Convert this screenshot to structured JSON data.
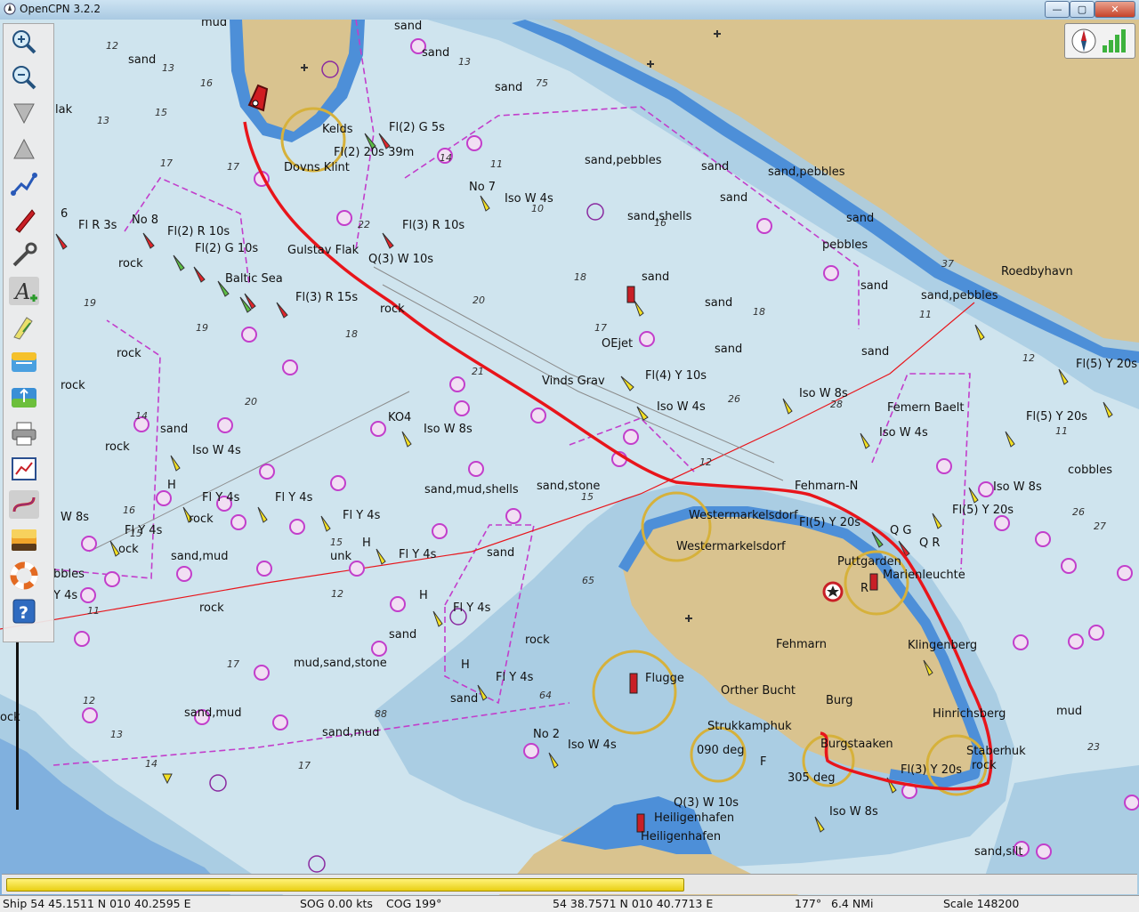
{
  "window": {
    "title": "OpenCPN 3.2.2",
    "minimize_glyph": "—",
    "maximize_glyph": "▢",
    "close_glyph": "✕"
  },
  "toolbar": {
    "tools": [
      {
        "name": "zoom-in-icon"
      },
      {
        "name": "zoom-out-icon"
      },
      {
        "name": "scale-in-icon"
      },
      {
        "name": "scale-out-icon"
      },
      {
        "name": "route-icon"
      },
      {
        "name": "follow-ship-icon"
      },
      {
        "name": "settings-wrench-icon"
      },
      {
        "name": "text-toggle-icon"
      },
      {
        "name": "current-tide-icon"
      },
      {
        "name": "tide-icon"
      },
      {
        "name": "current-icon"
      },
      {
        "name": "print-icon"
      },
      {
        "name": "route-manager-icon"
      },
      {
        "name": "track-icon"
      },
      {
        "name": "color-scheme-icon"
      },
      {
        "name": "mob-lifebuoy-icon"
      },
      {
        "name": "help-icon"
      }
    ]
  },
  "chart": {
    "labels": [
      {
        "t": "mud"
      },
      {
        "t": "sand"
      },
      {
        "t": "sand"
      },
      {
        "t": "sand"
      },
      {
        "t": "sand"
      },
      {
        "t": "lak"
      },
      {
        "t": "Kelds"
      },
      {
        "t": "Fl(2) G 5s"
      },
      {
        "t": "Fl(2) 20s 39m"
      },
      {
        "t": "Dovns Klint"
      },
      {
        "t": "sand,pebbles"
      },
      {
        "t": "sand"
      },
      {
        "t": "sand,pebbles"
      },
      {
        "t": "No 7"
      },
      {
        "t": "Iso W 4s"
      },
      {
        "t": "sand"
      },
      {
        "t": "sand,shells"
      },
      {
        "t": "sand"
      },
      {
        "t": "No 8"
      },
      {
        "t": "6"
      },
      {
        "t": "Fl R 3s"
      },
      {
        "t": "Fl(2) R 10s"
      },
      {
        "t": "Fl(2) G 10s"
      },
      {
        "t": "Gulstav Flak"
      },
      {
        "t": "Fl(3) R 10s"
      },
      {
        "t": "Q(3) W 10s"
      },
      {
        "t": "pebbles"
      },
      {
        "t": "Baltic Sea"
      },
      {
        "t": "Fl(3) R 15s"
      },
      {
        "t": "rock"
      },
      {
        "t": "rock"
      },
      {
        "t": "sand"
      },
      {
        "t": "sand"
      },
      {
        "t": "sand"
      },
      {
        "t": "sand,pebbles"
      },
      {
        "t": "Roedbyhavn"
      },
      {
        "t": "OEjet"
      },
      {
        "t": "sand"
      },
      {
        "t": "sand"
      },
      {
        "t": "Fl(4) Y 10s"
      },
      {
        "t": "Vinds Grav"
      },
      {
        "t": "Iso W 4s"
      },
      {
        "t": "Iso W 8s"
      },
      {
        "t": "Femern Baelt"
      },
      {
        "t": "Fl(5) Y 20s"
      },
      {
        "t": "Fl(5) Y 20s"
      },
      {
        "t": "rock"
      },
      {
        "t": "rock"
      },
      {
        "t": "KO4"
      },
      {
        "t": "Iso W 8s"
      },
      {
        "t": "sand"
      },
      {
        "t": "Iso W 4s"
      },
      {
        "t": "Iso W 4s"
      },
      {
        "t": "cobbles"
      },
      {
        "t": "rock"
      },
      {
        "t": "sand,mud,shells"
      },
      {
        "t": "sand,stone"
      },
      {
        "t": "Fehmarn-N"
      },
      {
        "t": "Iso W 8s"
      },
      {
        "t": "H"
      },
      {
        "t": "Fl Y 4s"
      },
      {
        "t": "Fl Y 4s"
      },
      {
        "t": "Fl Y 4s"
      },
      {
        "t": "W 8s"
      },
      {
        "t": "rock"
      },
      {
        "t": "Fl Y 4s"
      },
      {
        "t": "Westermarkelsdorf"
      },
      {
        "t": "Westermarkelsdorf"
      },
      {
        "t": "Fl(5) Y 20s"
      },
      {
        "t": "Fl(5) Y 20s"
      },
      {
        "t": "Q G"
      },
      {
        "t": "Q R"
      },
      {
        "t": "ock"
      },
      {
        "t": "sand,mud"
      },
      {
        "t": "H"
      },
      {
        "t": "unk"
      },
      {
        "t": "Fl Y 4s"
      },
      {
        "t": "sand"
      },
      {
        "t": "Puttgarden"
      },
      {
        "t": "Marienleuchte"
      },
      {
        "t": "R"
      },
      {
        "t": "bbles"
      },
      {
        "t": "Y 4s"
      },
      {
        "t": "rock"
      },
      {
        "t": "H"
      },
      {
        "t": "Fl Y 4s"
      },
      {
        "t": "sand"
      },
      {
        "t": "rock"
      },
      {
        "t": "mud,sand,stone"
      },
      {
        "t": "Fehmarn"
      },
      {
        "t": "Klingenberg"
      },
      {
        "t": "H"
      },
      {
        "t": "Fl Y 4s"
      },
      {
        "t": "Flugge"
      },
      {
        "t": "Orther Bucht"
      },
      {
        "t": "sand,mud"
      },
      {
        "t": "sand"
      },
      {
        "t": "Burg"
      },
      {
        "t": "Hinrichsberg"
      },
      {
        "t": "mud"
      },
      {
        "t": "sand,mud"
      },
      {
        "t": "Strukkamphuk"
      },
      {
        "t": "No 2"
      },
      {
        "t": "Iso W 4s"
      },
      {
        "t": "Burgstaaken"
      },
      {
        "t": "Staberhuk"
      },
      {
        "t": "rock"
      },
      {
        "t": "090 deg"
      },
      {
        "t": "F"
      },
      {
        "t": "305 deg"
      },
      {
        "t": "Fl(3) Y 20s"
      },
      {
        "t": "ock"
      },
      {
        "t": "Q(3) W 10s"
      },
      {
        "t": "Heiligenhafen"
      },
      {
        "t": "Heiligenhafen"
      },
      {
        "t": "Iso W 8s"
      },
      {
        "t": "sand,silt"
      },
      {
        "t": "cobbles"
      }
    ],
    "soundings": [
      {
        "t": "12"
      },
      {
        "t": "13"
      },
      {
        "t": "16"
      },
      {
        "t": "15"
      },
      {
        "t": "13"
      },
      {
        "t": "17"
      },
      {
        "t": "75"
      },
      {
        "t": "13"
      },
      {
        "t": "14"
      },
      {
        "t": "11"
      },
      {
        "t": "17"
      },
      {
        "t": "22"
      },
      {
        "t": "10"
      },
      {
        "t": "20"
      },
      {
        "t": "19"
      },
      {
        "t": "18"
      },
      {
        "t": "18"
      },
      {
        "t": "18"
      },
      {
        "t": "17"
      },
      {
        "t": "16"
      },
      {
        "t": "19"
      },
      {
        "t": "20"
      },
      {
        "t": "12"
      },
      {
        "t": "15"
      },
      {
        "t": "16"
      },
      {
        "t": "12"
      },
      {
        "t": "14"
      },
      {
        "t": "15"
      },
      {
        "t": "17"
      },
      {
        "t": "11"
      },
      {
        "t": "13"
      },
      {
        "t": "11"
      },
      {
        "t": "11"
      },
      {
        "t": "21"
      },
      {
        "t": "12"
      },
      {
        "t": "26"
      },
      {
        "t": "26"
      },
      {
        "t": "28"
      },
      {
        "t": "27"
      },
      {
        "t": "37"
      },
      {
        "t": "64"
      },
      {
        "t": "88"
      },
      {
        "t": "14"
      },
      {
        "t": "15"
      },
      {
        "t": "12"
      },
      {
        "t": "17"
      },
      {
        "t": "23"
      },
      {
        "t": "65"
      }
    ]
  },
  "compass": {
    "compass_icon": "compass-icon",
    "signal_icon": "gps-signal-icon"
  },
  "progress": {
    "fill_percent": 60,
    "color": "#f4e33a"
  },
  "status": {
    "ship": "Ship 54 45.1511 N   010 40.2595 E",
    "sog": "SOG 0.00 kts",
    "cog": "COG 199°",
    "cursor": "54 38.7571 N   010 40.7713 E",
    "bearing": "177°",
    "distance": "6.4 NMi",
    "scale": "Scale 148200"
  },
  "colors": {
    "land": "#d9c38f",
    "deep_water": "#cfe4ee",
    "shallow_water": "#97bedf",
    "very_shallow": "#4d8fd8",
    "track": "#e8151b",
    "magenta": "#c23ecb"
  }
}
